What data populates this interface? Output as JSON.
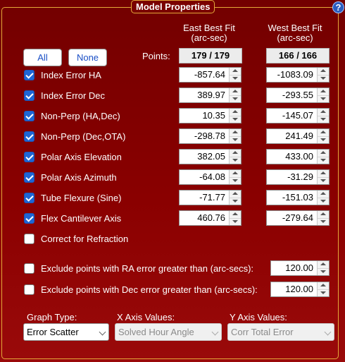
{
  "window": {
    "title": "Model Properties",
    "help": "?"
  },
  "columns": {
    "east": {
      "line1": "East Best Fit",
      "line2": "(arc-sec)"
    },
    "west": {
      "line1": "West Best Fit",
      "line2": "(arc-sec)"
    }
  },
  "buttons": {
    "all": "All",
    "none": "None"
  },
  "points": {
    "label": "Points:",
    "east": "179 / 179",
    "west": "166 / 166"
  },
  "terms": [
    {
      "label": "Index Error HA",
      "checked": true,
      "east": "-857.64",
      "west": "-1083.09"
    },
    {
      "label": "Index Error Dec",
      "checked": true,
      "east": "389.97",
      "west": "-293.55"
    },
    {
      "label": "Non-Perp (HA,Dec)",
      "checked": true,
      "east": "10.35",
      "west": "-145.07"
    },
    {
      "label": "Non-Perp (Dec,OTA)",
      "checked": true,
      "east": "-298.78",
      "west": "241.49"
    },
    {
      "label": "Polar Axis Elevation",
      "checked": true,
      "east": "382.05",
      "west": "433.00"
    },
    {
      "label": "Polar Axis Azimuth",
      "checked": true,
      "east": "-64.08",
      "west": "-31.29"
    },
    {
      "label": "Tube Flexure (Sine)",
      "checked": true,
      "east": "-71.77",
      "west": "-151.03"
    },
    {
      "label": "Flex Cantilever Axis",
      "checked": true,
      "east": "460.76",
      "west": "-279.64"
    }
  ],
  "refraction": {
    "label": "Correct for Refraction",
    "checked": false
  },
  "exclude_ra": {
    "label": "Exclude points with RA error greater than (arc-secs):",
    "checked": false,
    "value": "120.00"
  },
  "exclude_dec": {
    "label": "Exclude points with Dec error greater than (arc-secs):",
    "checked": false,
    "value": "120.00"
  },
  "graph": {
    "type_label": "Graph Type:",
    "type_value": "Error Scatter",
    "x_label": "X Axis Values:",
    "x_value": "Solved Hour Angle",
    "y_label": "Y Axis Values:",
    "y_value": "Corr Total Error"
  },
  "colors": {
    "background": "#8a0000",
    "frame": "#e3a93a",
    "checkbox": "#1e66d6",
    "button_text": "#1a4fc6"
  }
}
